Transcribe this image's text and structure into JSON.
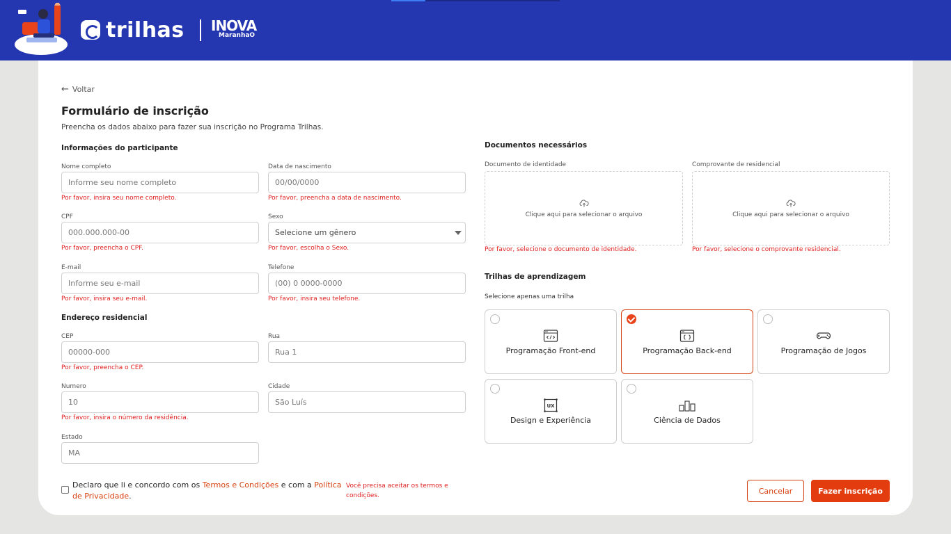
{
  "header": {
    "brand": "trilhas",
    "partner_big": "INOVA",
    "partner_small": "MaranhaO"
  },
  "page": {
    "back_label": "Voltar",
    "title": "Formulário de inscrição",
    "subtitle": "Preencha os dados abaixo para fazer sua inscrição no Programa Trilhas."
  },
  "participant": {
    "heading": "Informações do participante",
    "name": {
      "label": "Nome completo",
      "placeholder": "Informe seu nome completo",
      "error": "Por favor, insira seu nome completo."
    },
    "birth": {
      "label": "Data de nascimento",
      "placeholder": "00/00/0000",
      "error": "Por favor, preencha a data de nascimento."
    },
    "cpf": {
      "label": "CPF",
      "placeholder": "000.000.000-00",
      "error": "Por favor, preencha o CPF."
    },
    "sex": {
      "label": "Sexo",
      "selected": "Selecione um gênero",
      "error": "Por favor, escolha o Sexo."
    },
    "email": {
      "label": "E-mail",
      "placeholder": "Informe seu e-mail",
      "error": "Por favor, insira seu e-mail."
    },
    "phone": {
      "label": "Telefone",
      "placeholder": "(00) 0 0000-0000",
      "error": "Por favor, insira seu telefone."
    }
  },
  "address": {
    "heading": "Endereço residencial",
    "cep": {
      "label": "CEP",
      "placeholder": "00000-000",
      "error": "Por favor, preencha o CEP."
    },
    "street": {
      "label": "Rua",
      "placeholder": "Rua 1"
    },
    "number": {
      "label": "Numero",
      "placeholder": "10",
      "error": "Por favor, insira o número da residência."
    },
    "city": {
      "label": "Cidade",
      "placeholder": "São Luís"
    },
    "state": {
      "label": "Estado",
      "placeholder": "MA"
    }
  },
  "documents": {
    "heading": "Documentos necessários",
    "identity": {
      "label": "Documento de identidade",
      "cta": "Clique aqui para selecionar o arquivo",
      "error": "Por favor, selecione o documento de identidade."
    },
    "residence": {
      "label": "Comprovante de residencial",
      "cta": "Clique aqui para selecionar o arquivo",
      "error": "Por favor, selecione o comprovante residencial."
    }
  },
  "tracks": {
    "heading": "Trilhas de aprendizagem",
    "hint": "Selecione apenas uma trilha",
    "items": [
      {
        "label": "Programação Front-end",
        "icon": "code-window-icon",
        "selected": false
      },
      {
        "label": "Programação Back-end",
        "icon": "brackets-window-icon",
        "selected": true
      },
      {
        "label": "Programação de Jogos",
        "icon": "gamepad-icon",
        "selected": false
      },
      {
        "label": "Design e Experiência",
        "icon": "ux-icon",
        "selected": false
      },
      {
        "label": "Ciência de Dados",
        "icon": "bar-chart-icon",
        "selected": false
      }
    ]
  },
  "footer": {
    "terms_prefix": "Declaro que li e concordo com os ",
    "terms_link": "Termos e Condições",
    "terms_middle": " e com a ",
    "privacy_link": "Política de Privacidade",
    "terms_suffix": ".",
    "terms_error": "Você precisa aceitar os termos e condições.",
    "cancel_label": "Cancelar",
    "submit_label": "Fazer inscrição"
  },
  "colors": {
    "header_bg": "#2436b0",
    "accent": "#e23c0f",
    "error": "#e02020"
  }
}
